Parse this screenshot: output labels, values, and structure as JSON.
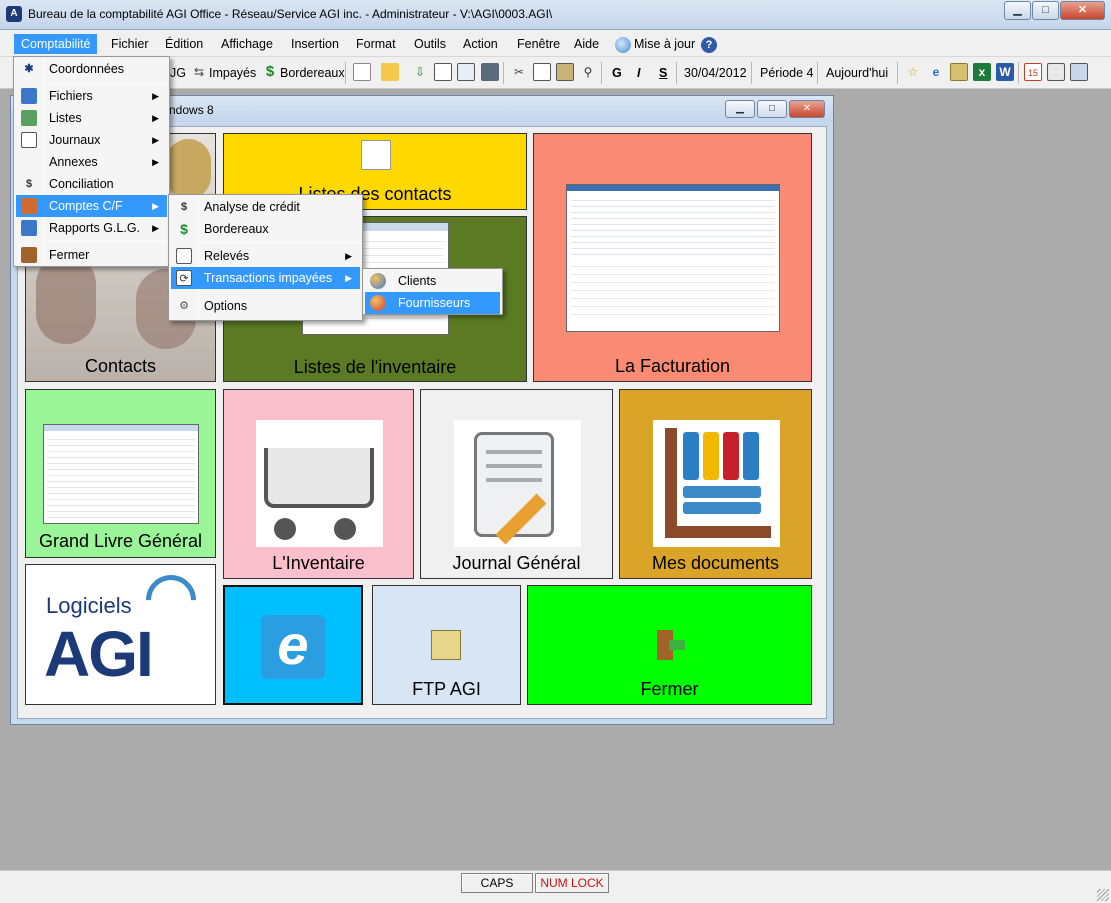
{
  "window": {
    "title": "Bureau de la comptabilité AGI Office - Réseau/Service AGI inc. - Administrateur - V:\\AGI\\0003.AGI\\",
    "minimize": "▁",
    "maximize": "□",
    "close": "✕"
  },
  "menubar": {
    "items": [
      "Comptabilité",
      "Fichier",
      "Édition",
      "Affichage",
      "Insertion",
      "Format",
      "Outils",
      "Action",
      "Fenêtre",
      "Aide",
      "Mise à jour"
    ]
  },
  "toolbar": {
    "partial_label": "JG",
    "impayes": "Impayés",
    "bordereaux": "Bordereaux",
    "bold": "G",
    "italic": "I",
    "underline": "S",
    "date": "30/04/2012",
    "period": "Période 4",
    "today": "Aujourd'hui"
  },
  "child_window": {
    "title_partial": "ndows 8"
  },
  "tiles": {
    "contacts": "Contacts",
    "listes_contacts": "Listes des contacts",
    "listes_inventaire": "Listes de l'inventaire",
    "facturation": "La Facturation",
    "grand_livre": "Grand Livre Général",
    "inventaire": "L'Inventaire",
    "journal": "Journal Général",
    "documents": "Mes documents",
    "logo_top": "Logiciels",
    "logo_bottom": "AGI",
    "ftp": "FTP AGI",
    "fermer": "Fermer"
  },
  "menu_comptabilite": {
    "items": [
      {
        "label": "Coordonnées"
      },
      {
        "label": "Fichiers"
      },
      {
        "label": "Listes"
      },
      {
        "label": "Journaux"
      },
      {
        "label": "Annexes"
      },
      {
        "label": "Conciliation"
      },
      {
        "label": "Comptes C/F"
      },
      {
        "label": "Rapports G.L.G."
      },
      {
        "label": "Fermer"
      }
    ]
  },
  "menu_comptes": {
    "items": [
      {
        "label": "Analyse de crédit"
      },
      {
        "label": "Bordereaux"
      },
      {
        "label": "Relevés"
      },
      {
        "label": "Transactions impayées"
      },
      {
        "label": "Options"
      }
    ]
  },
  "menu_transactions": {
    "items": [
      {
        "label": "Clients"
      },
      {
        "label": "Fournisseurs"
      }
    ]
  },
  "status": {
    "caps": "CAPS",
    "num_lock": "NUM LOCK"
  },
  "colors": {
    "yellow": "#ffd800",
    "olive": "#5c7a24",
    "salmon": "#f98a74",
    "light_green": "#99f598",
    "pink": "#f9c0cb",
    "light_gray": "#f0f0f0",
    "gold": "#d9a427",
    "cyan": "#00bfff",
    "light_blue": "#d7e5f4",
    "green": "#00ff00",
    "highlight": "#3399ff"
  }
}
